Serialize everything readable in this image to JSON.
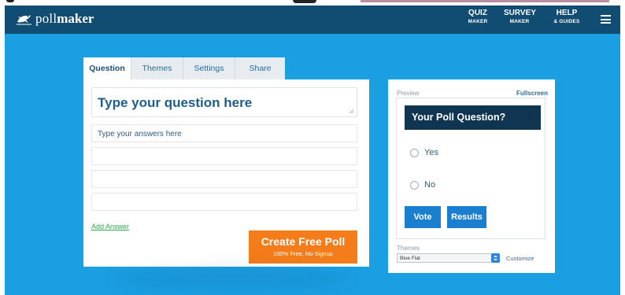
{
  "brand": {
    "logo_light": "poll",
    "logo_bold": "maker"
  },
  "nav": {
    "quiz": {
      "line1": "QUIZ",
      "line2": "MAKER"
    },
    "survey": {
      "line1": "SURVEY",
      "line2": "MAKER"
    },
    "help": {
      "line1": "HELP",
      "line2": "& GUIDES"
    }
  },
  "tabs": [
    {
      "label": "Question",
      "active": true
    },
    {
      "label": "Themes",
      "active": false
    },
    {
      "label": "Settings",
      "active": false
    },
    {
      "label": "Share",
      "active": false
    }
  ],
  "editor": {
    "question_placeholder": "Type your question here",
    "answers": [
      {
        "placeholder": "Type your answers here"
      },
      {
        "placeholder": ""
      },
      {
        "placeholder": ""
      },
      {
        "placeholder": ""
      }
    ],
    "add_answer": "Add Answer",
    "create_button": {
      "title": "Create Free Poll",
      "subtitle": "100% Free, No Signup"
    }
  },
  "preview": {
    "label": "Preview",
    "fullscreen": "Fullscreen",
    "question": "Your Poll Question?",
    "options": [
      "Yes",
      "No"
    ],
    "vote": "Vote",
    "results": "Results",
    "themes_label": "Themes",
    "theme_selected": "Blue Flat",
    "customize": "Customize"
  },
  "colors": {
    "navbar": "#114d73",
    "background": "#1a9fe3",
    "accent_orange": "#f47c1a",
    "button_blue": "#1a7fcf",
    "question_bar": "#0f3550"
  }
}
